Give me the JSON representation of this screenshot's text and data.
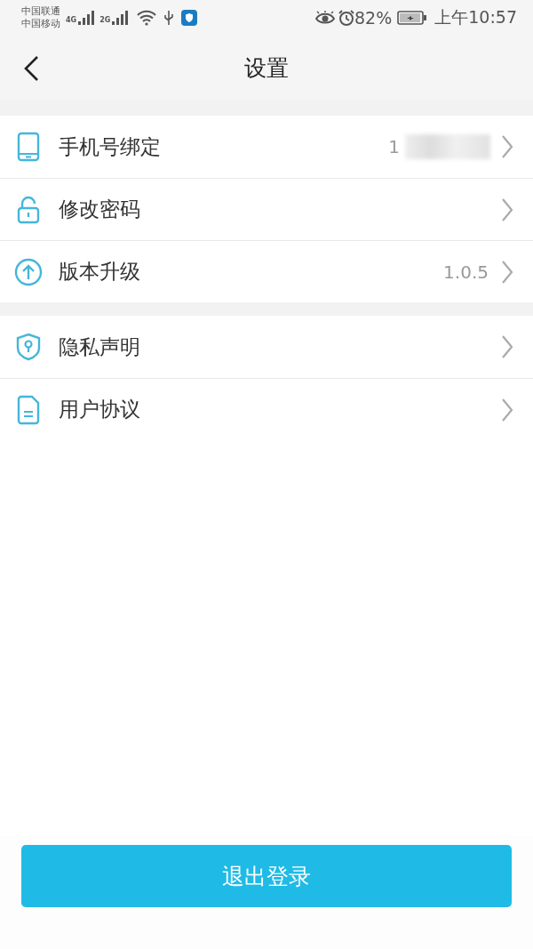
{
  "status_bar": {
    "carriers": [
      "中国联通",
      "中国移动"
    ],
    "network_labels": [
      "4G",
      "2G"
    ],
    "battery": "82%",
    "time": "上午10:57"
  },
  "header": {
    "title": "设置"
  },
  "groups": [
    {
      "items": [
        {
          "label": "手机号绑定",
          "value": "1"
        },
        {
          "label": "修改密码"
        },
        {
          "label": "版本升级",
          "value": "1.0.5"
        }
      ]
    },
    {
      "items": [
        {
          "label": "隐私声明"
        },
        {
          "label": "用户协议"
        }
      ]
    }
  ],
  "logout_button": "退出登录"
}
